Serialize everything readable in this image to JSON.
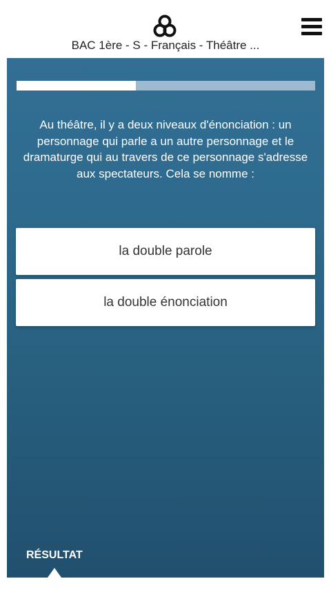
{
  "header": {
    "logo_icon": "trefoil-logo-icon",
    "title": "BAC 1ère - S - Français - Théâtre ...",
    "menu_icon": "hamburger-menu-icon"
  },
  "progress": {
    "fraction": 0.4
  },
  "question": {
    "text": "Au théâtre, il y a deux niveaux d'énonciation : un personnage qui parle a un autre personnage et le dramaturge qui au travers de ce personnage s'adresse aux spectateurs. Cela se nomme :"
  },
  "answers": [
    {
      "label": "la double parole"
    },
    {
      "label": "la double énonciation"
    }
  ],
  "footer": {
    "result_label": "RÉSULTAT"
  },
  "colors": {
    "background_top": "#336f94",
    "background_bottom": "#21506e",
    "progress_track": "#9dbbd0",
    "progress_fill": "#ffffff"
  }
}
